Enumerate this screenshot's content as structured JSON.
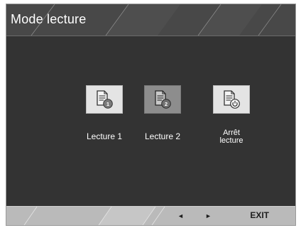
{
  "window": {
    "title": "Mode lecture"
  },
  "options": [
    {
      "label": "Lecture 1",
      "icon": "document-reading-1-icon",
      "selected": false
    },
    {
      "label": "Lecture 2",
      "icon": "document-reading-2-icon",
      "selected": true
    },
    {
      "label_lines": [
        "Arrêt",
        "lecture"
      ],
      "icon": "document-power-off-icon",
      "selected": false
    }
  ],
  "footer": {
    "left_arrow": "◄",
    "right_arrow": "►",
    "exit_label": "EXIT"
  },
  "colors": {
    "panel_bg": "#333333",
    "header_bg": "#484848",
    "footer_bg": "#bababa",
    "icon_bg": "#e4e4e4",
    "icon_selected_bg": "#8d8d8d",
    "text": "#ffffff"
  }
}
